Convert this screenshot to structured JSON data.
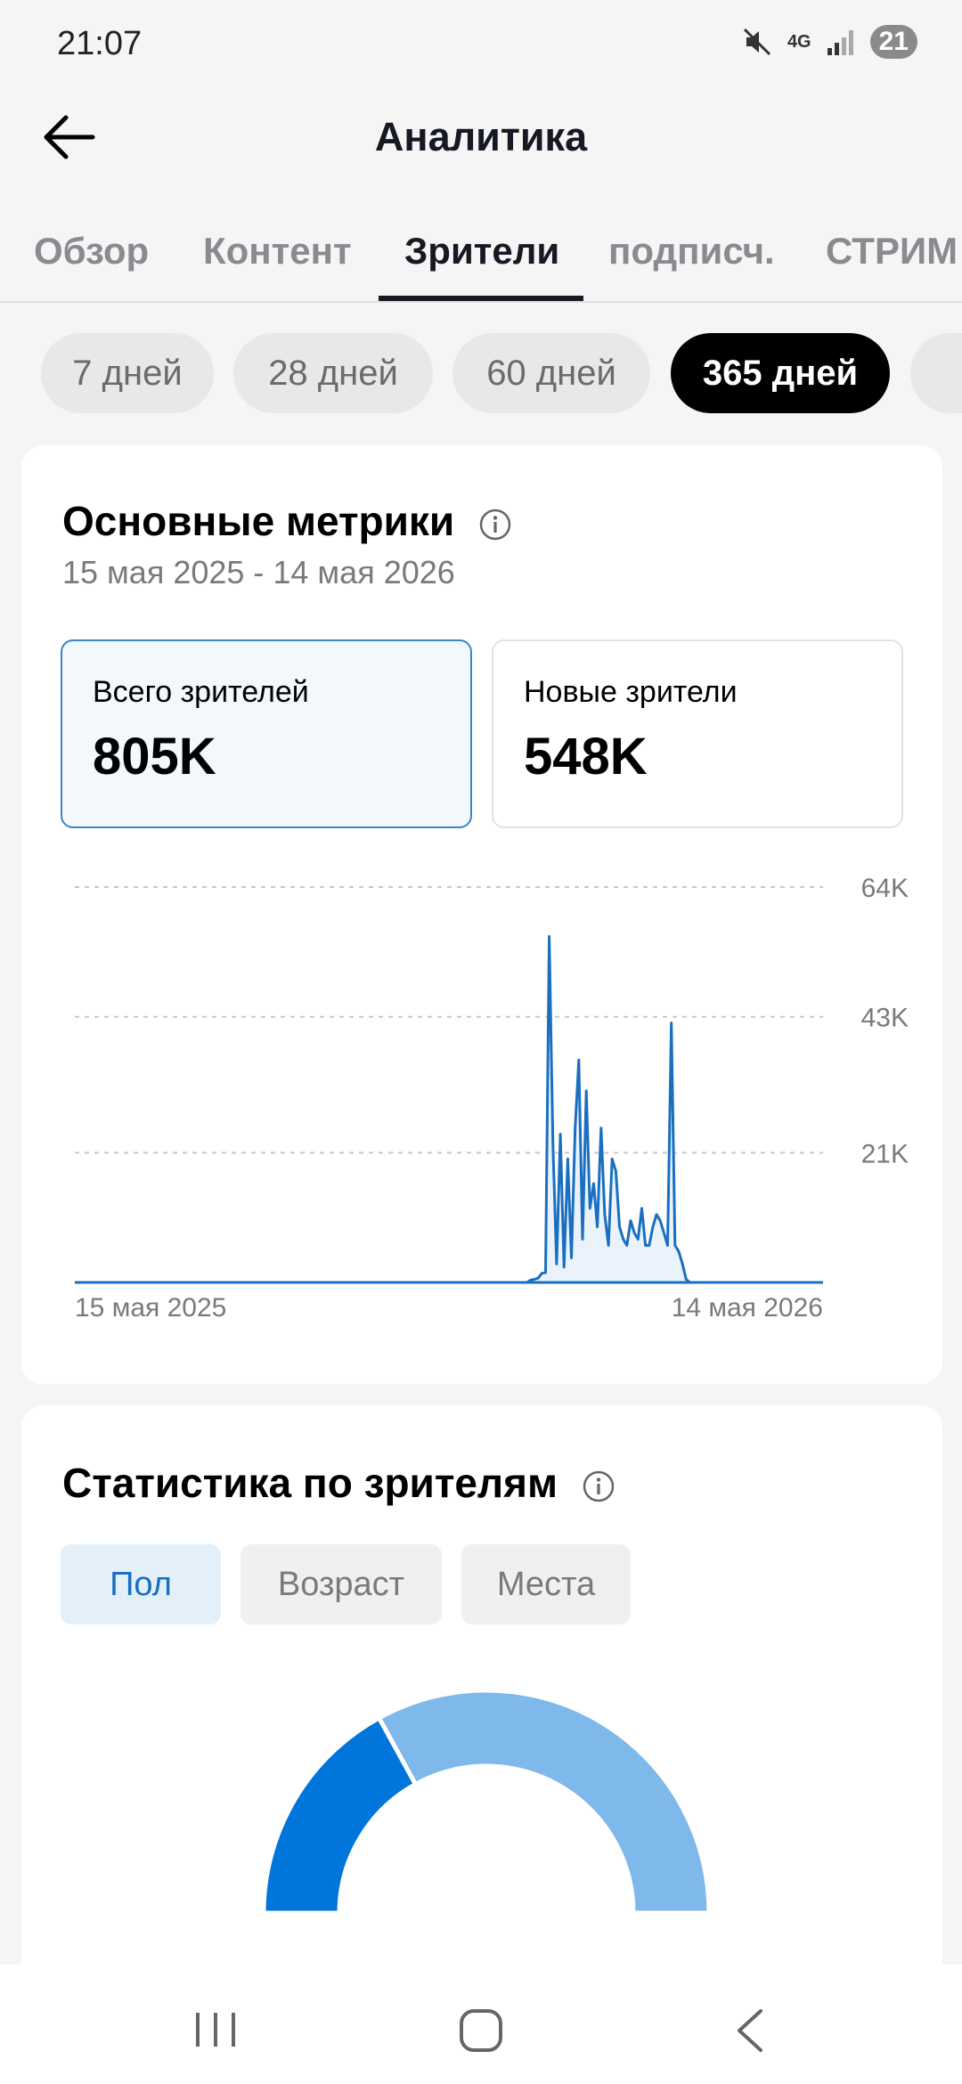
{
  "status": {
    "time": "21:07",
    "network": "4G",
    "battery": "21"
  },
  "header": {
    "title": "Аналитика"
  },
  "tabs": [
    {
      "label": "Обзор"
    },
    {
      "label": "Контент"
    },
    {
      "label": "Зрители"
    },
    {
      "label": "подписч."
    },
    {
      "label": "СТРИМ"
    }
  ],
  "active_tab": "Зрители",
  "periods": [
    {
      "label": "7 дней"
    },
    {
      "label": "28 дней"
    },
    {
      "label": "60 дней"
    },
    {
      "label": "365 дней"
    }
  ],
  "active_period": "365 дней",
  "metrics_card": {
    "title": "Основные метрики",
    "date_range": "15 мая 2025 - 14 мая 2026",
    "total": {
      "label": "Всего зрителей",
      "value": "805K"
    },
    "new": {
      "label": "Новые зрители",
      "value": "548K"
    }
  },
  "stats_card": {
    "title": "Статистика по зрителям",
    "tabs": [
      {
        "label": "Пол"
      },
      {
        "label": "Возраст"
      },
      {
        "label": "Места"
      }
    ]
  },
  "colors": {
    "accent": "#0075db",
    "accent_light": "#7fb8ea",
    "active_pill": "#000000"
  },
  "chart_data": [
    {
      "type": "area",
      "xlabel": "",
      "ylabel": "",
      "x_tick_labels": [
        "15 мая 2025",
        "14 мая 2026"
      ],
      "y_tick_labels": [
        "64K",
        "43K",
        "21K"
      ],
      "y_ticks": [
        64000,
        43000,
        21000
      ],
      "ylim": [
        0,
        64000
      ],
      "grid": true,
      "series": [
        {
          "values": [
            0,
            400,
            500,
            700,
            1500,
            1600,
            56000,
            22000,
            3000,
            24000,
            2500,
            20000,
            4000,
            25000,
            36000,
            7000,
            31000,
            12000,
            16000,
            9000,
            25000,
            11000,
            6000,
            20000,
            18000,
            9000,
            7000,
            6000,
            10000,
            8000,
            7000,
            12000,
            6000,
            6000,
            9000,
            11000,
            10000,
            8000,
            6000,
            42000,
            6000,
            5000,
            3000,
            500,
            0
          ]
        }
      ],
      "x_index_range": [
        0,
        364
      ],
      "active_start_index": 220
    },
    {
      "type": "pie",
      "variant": "half-donut",
      "values": [
        34,
        66
      ],
      "colors": [
        "#0075db",
        "#7fb8ea"
      ]
    }
  ]
}
